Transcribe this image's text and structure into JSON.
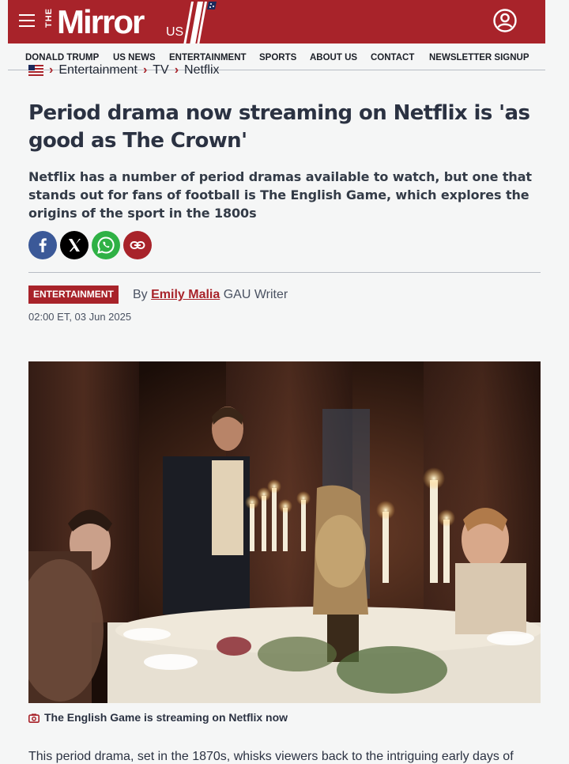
{
  "header": {
    "logo_the": "THE",
    "logo_word": "Mirror",
    "logo_us": "US",
    "menu_icon": "hamburger-menu-icon",
    "account_icon": "user-account-icon",
    "brand_color": "#a8232a"
  },
  "nav": {
    "items": [
      "DONALD TRUMP",
      "US NEWS",
      "ENTERTAINMENT",
      "SPORTS",
      "ABOUT US",
      "CONTACT",
      "NEWSLETTER SIGNUP"
    ]
  },
  "breadcrumb": {
    "items": [
      "Entertainment",
      "TV",
      "Netflix"
    ]
  },
  "article": {
    "headline": "Period drama now streaming on Netflix is 'as good as The Crown'",
    "standfirst": "Netflix has a number of period dramas available to watch, but one that stands out for fans of football is The English Game, which explores the origins of the sport in the 1800s",
    "share": [
      "facebook-icon",
      "x-icon",
      "whatsapp-icon",
      "copy-link-icon"
    ],
    "tag": "ENTERTAINMENT",
    "byline_prefix": "By",
    "author": "Emily Malia",
    "author_role": "GAU Writer",
    "date": "02:00 ET, 03 Jun 2025",
    "image_caption": "The English Game is streaming on Netflix now",
    "body_start": "This period drama, set in the 1870s, whisks viewers back to the intriguing early days of"
  }
}
